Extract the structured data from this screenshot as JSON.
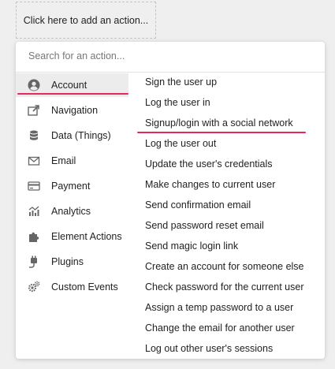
{
  "add_action": {
    "label": "Click here to add an action..."
  },
  "search": {
    "placeholder": "Search for an action..."
  },
  "categories": [
    {
      "label": "Account",
      "icon": "user-circle-icon",
      "active": true
    },
    {
      "label": "Navigation",
      "icon": "external-link-icon"
    },
    {
      "label": "Data (Things)",
      "icon": "database-icon"
    },
    {
      "label": "Email",
      "icon": "envelope-icon"
    },
    {
      "label": "Payment",
      "icon": "credit-card-icon"
    },
    {
      "label": "Analytics",
      "icon": "analytics-chart-icon"
    },
    {
      "label": "Element Actions",
      "icon": "puzzle-piece-icon"
    },
    {
      "label": "Plugins",
      "icon": "plug-icon"
    },
    {
      "label": "Custom Events",
      "icon": "gears-icon"
    }
  ],
  "actions": [
    {
      "label": "Sign the user up"
    },
    {
      "label": "Log the user in"
    },
    {
      "label": "Signup/login with a social network",
      "highlighted": true
    },
    {
      "label": "Log the user out"
    },
    {
      "label": "Update the user's credentials"
    },
    {
      "label": "Make changes to current user"
    },
    {
      "label": "Send confirmation email"
    },
    {
      "label": "Send password reset email"
    },
    {
      "label": "Send magic login link"
    },
    {
      "label": "Create an account for someone else"
    },
    {
      "label": "Check password for the current user"
    },
    {
      "label": "Assign a temp password to a user"
    },
    {
      "label": "Change the email for another user"
    },
    {
      "label": "Log out other user's sessions"
    }
  ],
  "colors": {
    "highlight": "#e8275e",
    "icon": "#666666",
    "active_bg": "#ececec"
  }
}
